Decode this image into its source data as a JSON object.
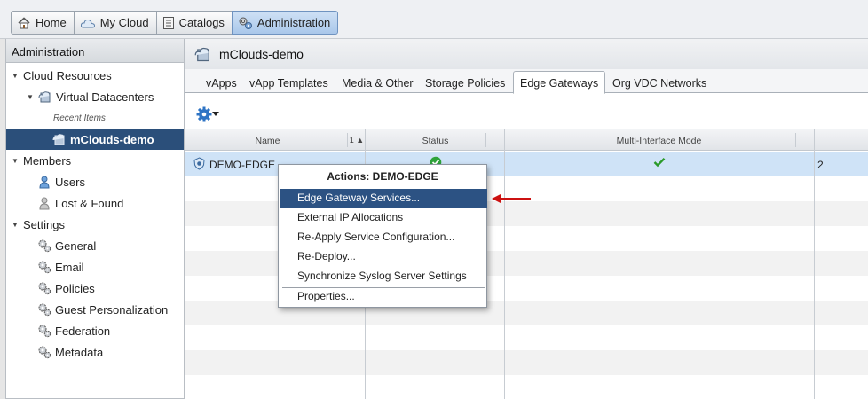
{
  "nav": {
    "home": "Home",
    "my_cloud": "My Cloud",
    "catalogs": "Catalogs",
    "administration": "Administration"
  },
  "sidebar": {
    "title": "Administration",
    "cloud_resources": "Cloud Resources",
    "virtual_datacenters": "Virtual Datacenters",
    "recent_items": "Recent Items",
    "mclouds_demo": "mClouds-demo",
    "members": "Members",
    "users": "Users",
    "lost_found": "Lost & Found",
    "settings": "Settings",
    "general": "General",
    "email": "Email",
    "policies": "Policies",
    "guest_personalization": "Guest Personalization",
    "federation": "Federation",
    "metadata": "Metadata"
  },
  "main": {
    "title": "mClouds-demo",
    "tabs": [
      {
        "label": "vApps"
      },
      {
        "label": "vApp Templates"
      },
      {
        "label": "Media & Other"
      },
      {
        "label": "Storage Policies"
      },
      {
        "label": "Edge Gateways"
      },
      {
        "label": "Org VDC Networks"
      }
    ]
  },
  "grid": {
    "columns": {
      "name": "Name",
      "sort": "1 ▲",
      "status": "Status",
      "multi_interface": "Multi-Interface Mode"
    },
    "rows": [
      {
        "name": "DEMO-EDGE",
        "extra": "2"
      }
    ]
  },
  "context_menu": {
    "title": "Actions: DEMO-EDGE",
    "items": [
      "Edge Gateway Services...",
      "External IP Allocations",
      "Re-Apply Service Configuration...",
      "Re-Deploy...",
      "Synchronize Syslog Server Settings",
      "Properties..."
    ]
  },
  "colors": {
    "selection": "#2c5283",
    "row_selected": "#cfe3f7",
    "check": "#2a9a2a",
    "arrow": "#cc1111"
  },
  "icons": [
    "home-icon",
    "cloud-icon",
    "catalog-icon",
    "admin-icon",
    "datacenter-icon",
    "user-icon",
    "gear-icon",
    "edge-gateway-icon",
    "check-icon",
    "red-arrow"
  ]
}
